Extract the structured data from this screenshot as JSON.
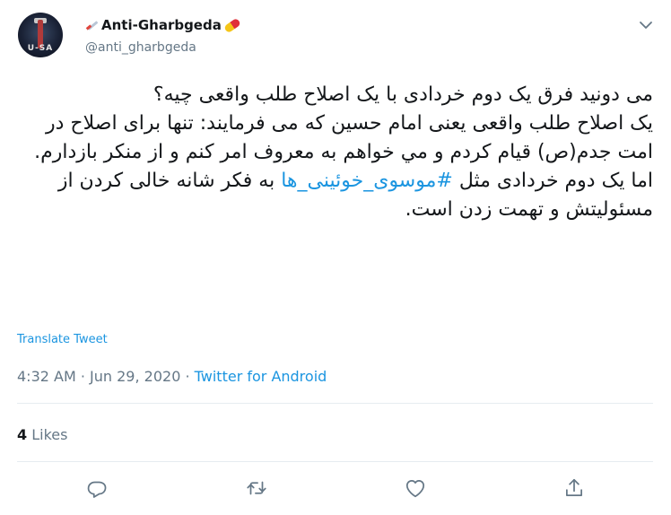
{
  "user": {
    "display_name": "Anti-Gharbgeda",
    "handle": "@anti_gharbgeda",
    "avatar_text": "U-SA"
  },
  "tweet": {
    "text_before_tag": "می دونید فرق یک دوم خردادی با یک اصلاح طلب واقعی چیه؟\nیک اصلاح طلب واقعی یعنی امام حسین که می فرمایند: تنها برای اصلاح در امت جدم(ص) قیام کردم و مي خواهم به معروف امر کنم و از منکر بازدارم.\nاما یک دوم خردادی مثل ",
    "hashtag": "#موسوی_خوئینی_ها",
    "text_after_tag": " به فکر شانه خالی کردن از مسئولیتش و تهمت زدن است.",
    "translate_label": "Translate Tweet"
  },
  "meta": {
    "time": "4:32 AM",
    "sep1": " · ",
    "date": "Jun 29, 2020",
    "sep2": " · ",
    "source": "Twitter for Android"
  },
  "stats": {
    "likes_count": "4",
    "likes_label": "Likes"
  },
  "icons": {
    "more": "chevron-down-icon",
    "reply": "reply-icon",
    "retweet": "retweet-icon",
    "like": "heart-icon",
    "share": "share-icon"
  },
  "colors": {
    "accent": "#1b95e0",
    "text": "#14171a",
    "muted": "#657786",
    "divider": "#e6ecf0"
  }
}
